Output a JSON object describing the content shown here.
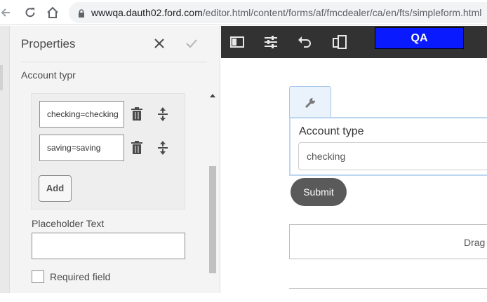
{
  "browser": {
    "url_host": "wwwqa.dauth02.ford.com",
    "url_path": "/editor.html/content/forms/af/fmcdealer/ca/en/fts/simpleform.html",
    "icons": [
      "back-icon",
      "reload-icon",
      "home-icon",
      "lock-icon"
    ]
  },
  "properties": {
    "title": "Properties",
    "field_name": "Account typr",
    "options": [
      {
        "value": "checking=checking"
      },
      {
        "value": "saving=saving"
      }
    ],
    "add_label": "Add",
    "placeholder_label": "Placeholder Text",
    "placeholder_value": "",
    "required_label": "Required field",
    "required_checked": false
  },
  "toolbar": {
    "icons": [
      "panel-toggle-icon",
      "settings-sliders-icon",
      "undo-icon",
      "emulator-icon"
    ],
    "badge": "QA",
    "badge_color": "#0a1aff"
  },
  "canvas": {
    "field_label": "Account type",
    "field_value": "checking",
    "submit_label": "Submit",
    "drop_text": "Drag"
  }
}
